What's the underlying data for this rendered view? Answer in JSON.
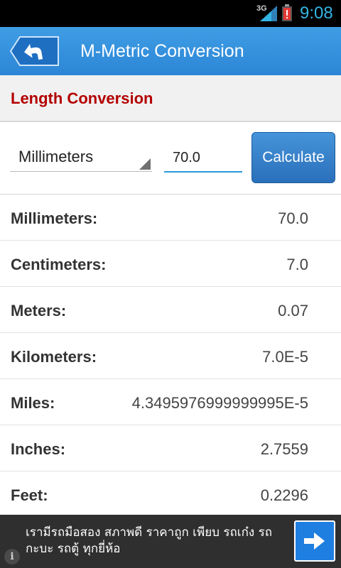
{
  "status": {
    "network": "3G",
    "time": "9:08",
    "colors": {
      "time": "#33b5e5",
      "battery_alert": "#e53935"
    }
  },
  "header": {
    "title": "M-Metric Conversion",
    "back_icon": "back-arrow-icon",
    "color": "#3a97e0"
  },
  "section": {
    "title": "Length Conversion",
    "color": "#b30000"
  },
  "input": {
    "unit": "Millimeters",
    "value": "70.0",
    "calculate_label": "Calculate"
  },
  "results": [
    {
      "label": "Millimeters:",
      "value": "70.0"
    },
    {
      "label": "Centimeters:",
      "value": "7.0"
    },
    {
      "label": "Meters:",
      "value": "0.07"
    },
    {
      "label": "Kilometers:",
      "value": "7.0E-5"
    },
    {
      "label": "Miles:",
      "value": "4.3495976999999995E-5"
    },
    {
      "label": "Inches:",
      "value": "2.7559"
    },
    {
      "label": "Feet:",
      "value": "0.2296"
    }
  ],
  "ad": {
    "text": "เรามีรถมือสอง สภาพดี ราคาถูก เพียบ รถเก๋ง รถกะบะ รถตู้ ทุกยี่ห้อ",
    "info_icon": "info-icon",
    "go_icon": "arrow-right-icon"
  }
}
